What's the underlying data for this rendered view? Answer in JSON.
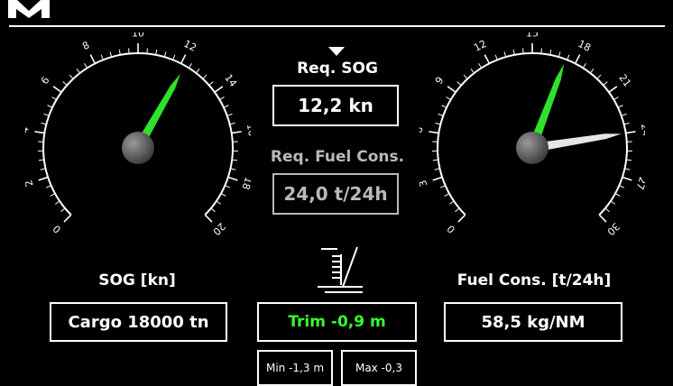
{
  "logo": {
    "name": "brand-logo-m"
  },
  "center_panel": {
    "req_sog_label": "Req. SOG",
    "req_sog_value": "12,2 kn",
    "req_fuel_label": "Req. Fuel Cons.",
    "req_fuel_value": "24,0 t/24h",
    "trim_icon": "trim-icon",
    "trim_value": "Trim -0,9 m",
    "trim_min": "Min -1,3 m",
    "trim_max": "Max -0,3"
  },
  "sog_gauge": {
    "label": "SOG [kn]",
    "min": 0,
    "max": 20,
    "tick_labels": [
      "0",
      "2",
      "4",
      "6",
      "8",
      "10",
      "12",
      "14",
      "16",
      "18",
      "20"
    ],
    "needle_value": 12.2,
    "needle_color": "#2fe12a"
  },
  "fuel_gauge": {
    "label": "Fuel Cons. [t/24h]",
    "min": 0,
    "max": 30,
    "tick_labels": [
      "0",
      "3",
      "6",
      "9",
      "12",
      "15",
      "18",
      "21",
      "24",
      "27",
      "30"
    ],
    "needle_actual": 17.3,
    "needle_actual_color": "#2fe12a",
    "needle_required": 24.0,
    "needle_required_color": "#e6e6e6"
  },
  "bottom": {
    "cargo_value": "Cargo 18000 tn",
    "efficiency_value": "58,5 kg/NM"
  },
  "colors": {
    "background": "#000000",
    "foreground": "#ffffff",
    "accent_green": "#39ff2a",
    "muted_grey": "#b9b9b9"
  }
}
